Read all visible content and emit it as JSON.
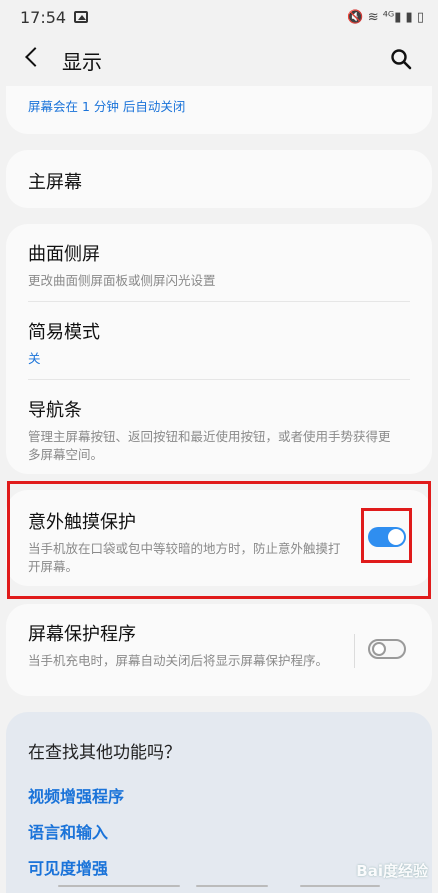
{
  "status": {
    "time": "17:54",
    "right_text": "🔇 ≋ ⁴ᴳ▮ ▮ ▯"
  },
  "header": {
    "title": "显示"
  },
  "top_partial": {
    "text": "屏幕会在 1 分钟 后自动关闭"
  },
  "home_screen": {
    "title": "主屏幕"
  },
  "edge_screen": {
    "title": "曲面侧屏",
    "subtitle": "更改曲面侧屏面板或侧屏闪光设置"
  },
  "easy_mode": {
    "title": "简易模式",
    "value": "关"
  },
  "nav_bar": {
    "title": "导航条",
    "subtitle": "管理主屏幕按钮、返回按钮和最近使用按钮，或者使用手势获得更多屏幕空间。"
  },
  "accidental_touch": {
    "title": "意外触摸保护",
    "subtitle": "当手机放在口袋或包中等较暗的地方时，防止意外触摸打开屏幕。",
    "enabled": true
  },
  "screen_saver": {
    "title": "屏幕保护程序",
    "subtitle": "当手机充电时，屏幕自动关闭后将显示屏幕保护程序。",
    "enabled": false
  },
  "suggestions": {
    "title": "在查找其他功能吗？",
    "links": [
      "视频增强程序",
      "语言和输入",
      "可见度增强"
    ]
  },
  "watermark": {
    "text": "Bai度经验"
  },
  "colors": {
    "accent": "#1a73d9",
    "toggle_on": "#2f8ef0",
    "highlight": "#e01b1b"
  }
}
